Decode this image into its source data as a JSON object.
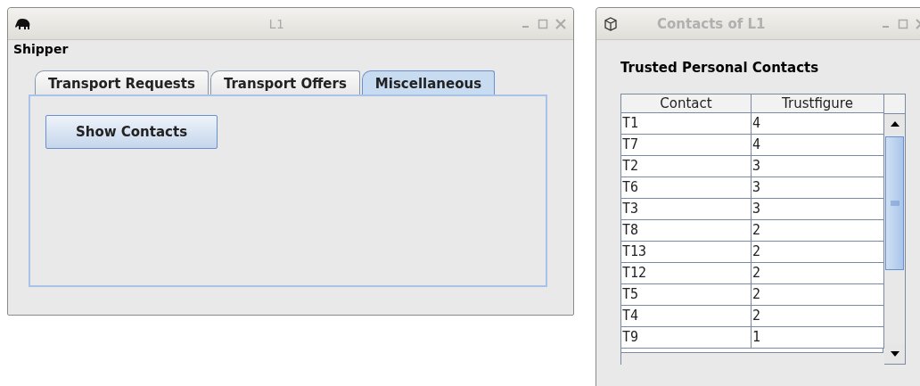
{
  "windows": [
    {
      "kind": "main",
      "title": "L1",
      "heading": "Shipper",
      "tabs": [
        {
          "label": "Transport Requests",
          "selected": false
        },
        {
          "label": "Transport Offers",
          "selected": false
        },
        {
          "label": "Miscellaneous",
          "selected": true
        }
      ],
      "button": "Show Contacts"
    },
    {
      "kind": "contacts",
      "title": "Contacts of L1",
      "heading": "Trusted Personal Contacts",
      "table": {
        "columns": [
          "Contact",
          "Trustfigure"
        ],
        "rows": [
          [
            "T1",
            "4"
          ],
          [
            "T7",
            "4"
          ],
          [
            "T2",
            "3"
          ],
          [
            "T6",
            "3"
          ],
          [
            "T3",
            "3"
          ],
          [
            "T8",
            "2"
          ],
          [
            "T13",
            "2"
          ],
          [
            "T12",
            "2"
          ],
          [
            "T5",
            "2"
          ],
          [
            "T4",
            "2"
          ],
          [
            "T9",
            "1"
          ]
        ]
      }
    }
  ]
}
